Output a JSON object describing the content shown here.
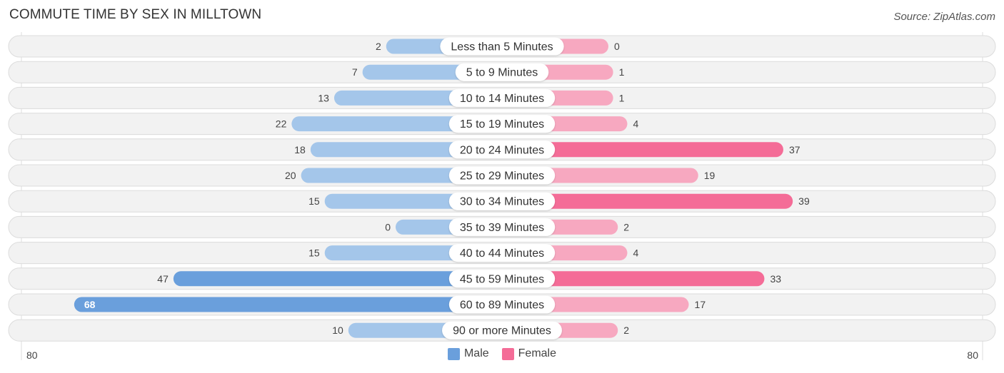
{
  "header": {
    "title": "COMMUTE TIME BY SEX IN MILLTOWN",
    "source": "Source: ZipAtlas.com"
  },
  "colors": {
    "male_strong": "#6a9fdc",
    "male_light": "#a4c6ea",
    "female_strong": "#f46c97",
    "female_light": "#f7a8c0",
    "row_bg": "#f2f2f2",
    "row_border": "#dcdcdc"
  },
  "legend": {
    "items": [
      {
        "label": "Male",
        "color": "#6a9fdc"
      },
      {
        "label": "Female",
        "color": "#f46c97"
      }
    ]
  },
  "chart_data": {
    "type": "bar",
    "orientation": "horizontal-diverging",
    "title": "COMMUTE TIME BY SEX IN MILLTOWN",
    "categories": [
      "Less than 5 Minutes",
      "5 to 9 Minutes",
      "10 to 14 Minutes",
      "15 to 19 Minutes",
      "20 to 24 Minutes",
      "25 to 29 Minutes",
      "30 to 34 Minutes",
      "35 to 39 Minutes",
      "40 to 44 Minutes",
      "45 to 59 Minutes",
      "60 to 89 Minutes",
      "90 or more Minutes"
    ],
    "series": [
      {
        "name": "Male",
        "side": "left",
        "values": [
          2,
          7,
          13,
          22,
          18,
          20,
          15,
          0,
          15,
          47,
          68,
          10
        ]
      },
      {
        "name": "Female",
        "side": "right",
        "values": [
          0,
          1,
          1,
          4,
          37,
          19,
          39,
          2,
          4,
          33,
          17,
          2
        ]
      }
    ],
    "axis": {
      "left_max_label": "80",
      "right_max_label": "80",
      "range": [
        0,
        80
      ]
    },
    "legend_position": "bottom-center",
    "grid": false
  }
}
